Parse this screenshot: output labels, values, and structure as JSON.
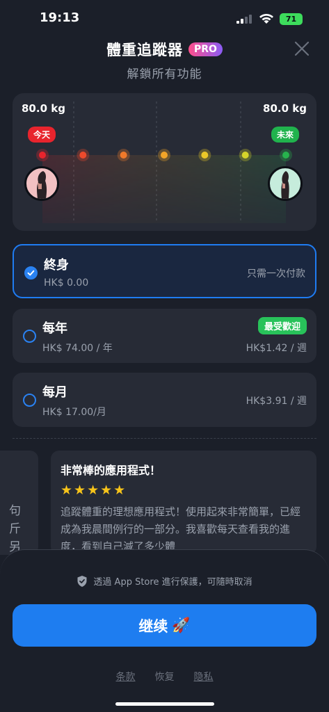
{
  "status_bar": {
    "time": "19:13",
    "battery": "71"
  },
  "header": {
    "title": "體重追蹤器",
    "pro_badge": "PRO",
    "subtitle": "解鎖所有功能"
  },
  "chart": {
    "start_weight": "80.0 kg",
    "end_weight": "80.0 kg",
    "today_tag": "今天",
    "future_tag": "未來",
    "point_colors": [
      "#e8242d",
      "#ee4a2c",
      "#f0792a",
      "#f2a528",
      "#ecc928",
      "#d6d52a",
      "#27b34d"
    ]
  },
  "plans": [
    {
      "name": "終身",
      "price": "HK$ 0.00",
      "note": "只需一次付款",
      "selected": true
    },
    {
      "name": "每年",
      "price": "HK$ 74.00 / 年",
      "badge": "最受歡迎",
      "note": "HK$1.42 / 週",
      "selected": false
    },
    {
      "name": "每月",
      "price": "HK$ 17.00/月",
      "note": "HK$3.91 / 週",
      "selected": false
    }
  ],
  "reviews": {
    "prev_partial_text": "句 斤 另",
    "current": {
      "title": "非常棒的應用程式！",
      "stars": "★★★★★",
      "body": "追蹤體重的理想應用程式！使用起來非常簡單，已經成為我晨間例行的一部分。我喜歡每天查看我的進度，看到自己減了多少體"
    }
  },
  "bottom": {
    "secure_text": "透過 App Store 進行保護，可隨時取消",
    "continue_label": "继续",
    "continue_emoji": "🚀",
    "links": {
      "terms": "条款",
      "restore": "恢复",
      "privacy": "隐私"
    }
  },
  "colors": {
    "accent": "#1e7df0",
    "popular_badge": "#28c25a",
    "pro_gradient_start": "#ff4f8b",
    "pro_gradient_end": "#8b5cf6"
  }
}
